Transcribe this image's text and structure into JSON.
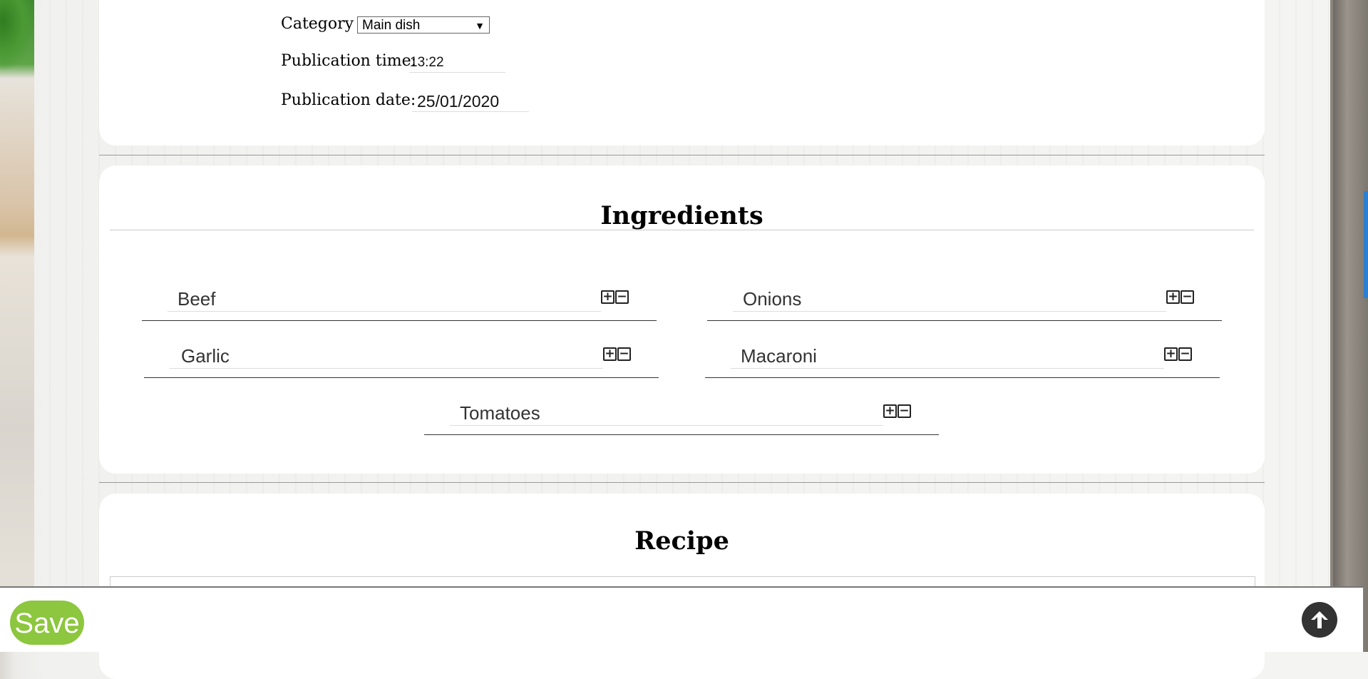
{
  "form": {
    "category_label": "Category :",
    "category_value": "Main dish",
    "time_label": "Publication time:",
    "time_value": "13:22",
    "date_label": "Publication date:",
    "date_value": "25/01/2020"
  },
  "ingredients": {
    "title": "Ingredients",
    "items": [
      "Beef",
      "Onions",
      "Garlic",
      "Macaroni",
      "Tomatoes"
    ],
    "add_icon": "plus-box-icon",
    "remove_icon": "minus-box-icon"
  },
  "recipe": {
    "title": "Recipe"
  },
  "footer": {
    "save_label": "Save",
    "save_color": "#8dc63f",
    "scroll_top_icon": "arrow-up-circle-icon"
  }
}
